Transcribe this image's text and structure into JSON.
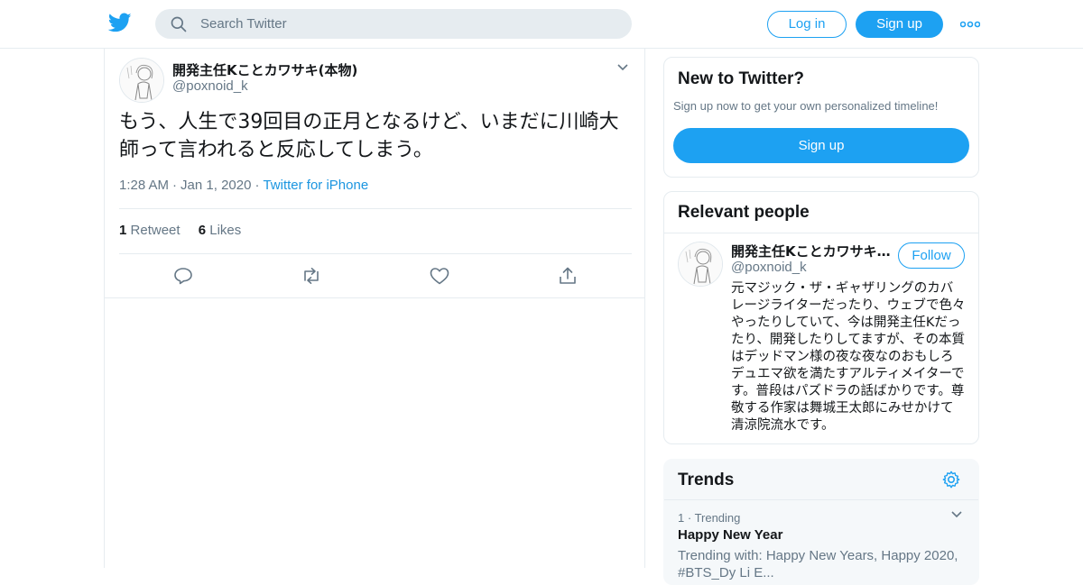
{
  "header": {
    "search_placeholder": "Search Twitter",
    "login_label": "Log in",
    "signup_label": "Sign up"
  },
  "tweet": {
    "author_name": "開発主任Kことカワサキ(本物)",
    "author_handle": "@poxnoid_k",
    "text": "もう、人生で39回目の正月となるけど、いまだに川崎大師って言われると反応してしまう。",
    "time": "1:28 AM",
    "date": "Jan 1, 2020",
    "source": "Twitter for iPhone",
    "retweet_count": "1",
    "retweet_label": "Retweet",
    "like_count": "6",
    "like_label": "Likes"
  },
  "sidebar": {
    "new_to_twitter": {
      "title": "New to Twitter?",
      "subtitle": "Sign up now to get your own personalized timeline!",
      "button_label": "Sign up"
    },
    "relevant_people": {
      "title": "Relevant people",
      "name": "開発主任Kことカワサキ(本物)",
      "handle": "@poxnoid_k",
      "follow_label": "Follow",
      "bio": "元マジック・ザ・ギャザリングのカバレージライターだったり、ウェブで色々やったりしていて、今は開発主任Kだったり、開発したりしてますが、その本質はデッドマン様の夜な夜なのおもしろデュエマ欲を満たすアルティメイターです。普段はパズドラの話ばかりです。尊敬する作家は舞城王太郎にみせかけて清涼院流水です。"
    },
    "trends": {
      "title": "Trends",
      "rank": "1",
      "rank_label": "Trending",
      "name": "Happy New Year",
      "with_text": "Trending with: Happy New Years, Happy 2020, #BTS_Dy Li E..."
    }
  },
  "colors": {
    "brand": "#1da1f2",
    "secondary_text": "#657786",
    "border": "#e6ecf0"
  },
  "icons": [
    "twitter-logo-icon",
    "search-icon",
    "more-icon",
    "chevron-down-icon",
    "reply-icon",
    "retweet-icon",
    "like-icon",
    "share-icon",
    "gear-icon"
  ]
}
